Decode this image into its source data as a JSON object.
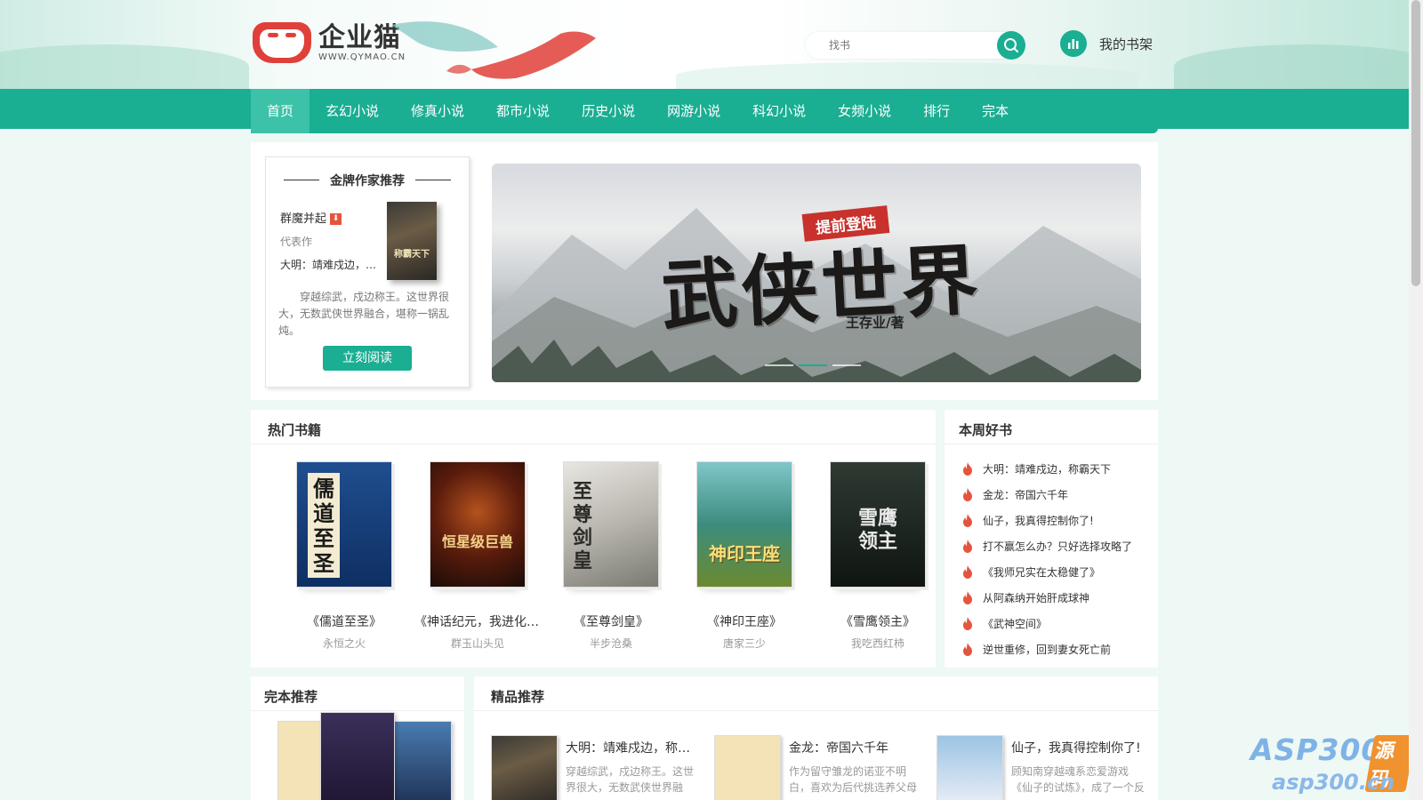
{
  "brand": {
    "name": "企业猫",
    "url": "WWW.QYMAO.CN",
    "accent": "#1aae92",
    "logo_red": "#e0403a"
  },
  "search": {
    "placeholder": "找书"
  },
  "shelf": {
    "label": "我的书架"
  },
  "nav": [
    "首页",
    "玄幻小说",
    "修真小说",
    "都市小说",
    "历史小说",
    "网游小说",
    "科幻小说",
    "女频小说",
    "排行",
    "完本"
  ],
  "author_box": {
    "title": "金牌作家推荐",
    "name": "群魔并起",
    "rep_label": "代表作",
    "rep_book": "大明：靖难戍边，称霸天下",
    "desc": "穿越综武，戍边称王。这世界很大，无数武侠世界融合，堪称一锅乱炖。",
    "read_button": "立刻阅读",
    "cover_text": "称霸天下"
  },
  "banner": {
    "tag": "提前登陆",
    "title": "武侠世界",
    "author": "王存业/著"
  },
  "hot": {
    "title": "热门书籍",
    "books": [
      {
        "title": "《儒道至圣》",
        "author": "永恒之火",
        "cover_text": "儒道至圣"
      },
      {
        "title": "《神话纪元，我进化成了恒星级巨兽》",
        "author": "群玉山头见",
        "cover_text": "恒星级巨兽"
      },
      {
        "title": "《至尊剑皇》",
        "author": "半步沧桑",
        "cover_text": "至尊剑皇"
      },
      {
        "title": "《神印王座》",
        "author": "唐家三少",
        "cover_text": "神印王座"
      },
      {
        "title": "《雪鹰领主》",
        "author": "我吃西红柿",
        "cover_text": "雪鹰领主"
      }
    ]
  },
  "week": {
    "title": "本周好书",
    "items": [
      "大明：靖难戍边，称霸天下",
      "金龙：帝国六千年",
      "仙子，我真得控制你了!",
      "打不赢怎么办？只好选择攻略了",
      "《我师兄实在太稳健了》",
      "从阿森纳开始肝成球神",
      "《武神空间》",
      "逆世重修，回到妻女死亡前"
    ]
  },
  "full": {
    "title": "完本推荐"
  },
  "fine": {
    "title": "精品推荐",
    "items": [
      {
        "title": "大明：靖难戍边，称霸天下",
        "desc": "穿越综武，戍边称王。这世界很大，无数武侠世界融合，堪称一锅乱炖。"
      },
      {
        "title": "金龙：帝国六千年",
        "desc": "作为留守雏龙的诺亚不明白，喜欢为后代挑选养父母的龙族。"
      },
      {
        "title": "仙子，我真得控制你了!",
        "desc": "顾知南穿越魂系恋爱游戏《仙子的试炼》，成了一个反派。"
      }
    ]
  },
  "watermark": {
    "a": "ASP300",
    "b": "源码",
    "c": "asp300.cn"
  }
}
